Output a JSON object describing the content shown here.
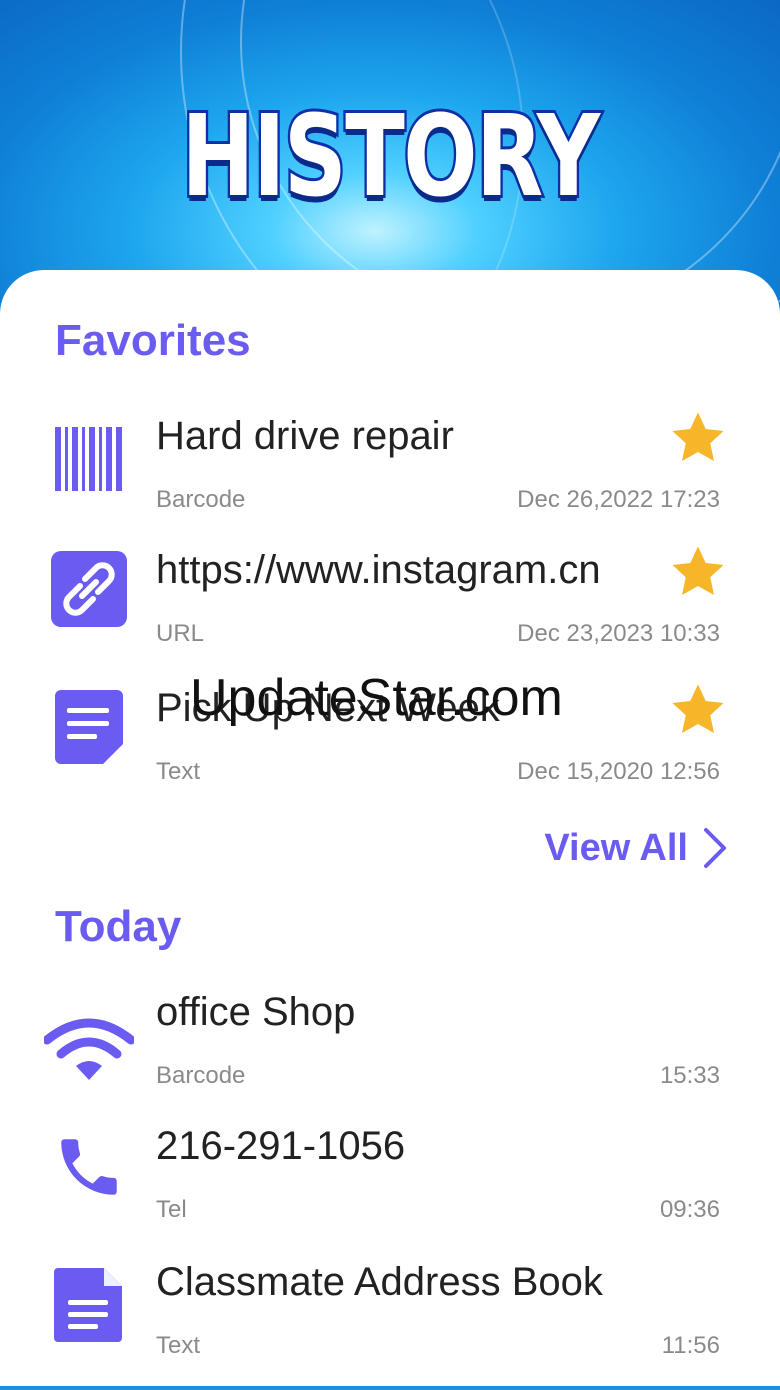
{
  "header": {
    "title": "HISTORY"
  },
  "favorites": {
    "title": "Favorites",
    "items": [
      {
        "name": "Hard drive repair",
        "type": "Barcode",
        "time": "Dec 26,2022 17:23",
        "icon": "barcode-icon"
      },
      {
        "name": "https://www.instagram.cn",
        "type": "URL",
        "time": "Dec 23,2023 10:33",
        "icon": "link-icon"
      },
      {
        "name": "Pick Up Next Week",
        "type": "Text",
        "time": "Dec 15,2020 12:56",
        "icon": "text-note-icon"
      }
    ],
    "view_all_label": "View All"
  },
  "today": {
    "title": "Today",
    "items": [
      {
        "name": "office Shop",
        "type": "Barcode",
        "time": "15:33",
        "icon": "wifi-icon"
      },
      {
        "name": "216-291-1056",
        "type": "Tel",
        "time": "09:36",
        "icon": "phone-icon"
      },
      {
        "name": "Classmate Address Book",
        "type": "Text",
        "time": "11:56",
        "icon": "document-icon"
      }
    ]
  },
  "watermark": "UpdateStar.com",
  "colors": {
    "accent": "#6a5cf0",
    "star": "#f7b52a",
    "hero": "#1a8fe0"
  }
}
